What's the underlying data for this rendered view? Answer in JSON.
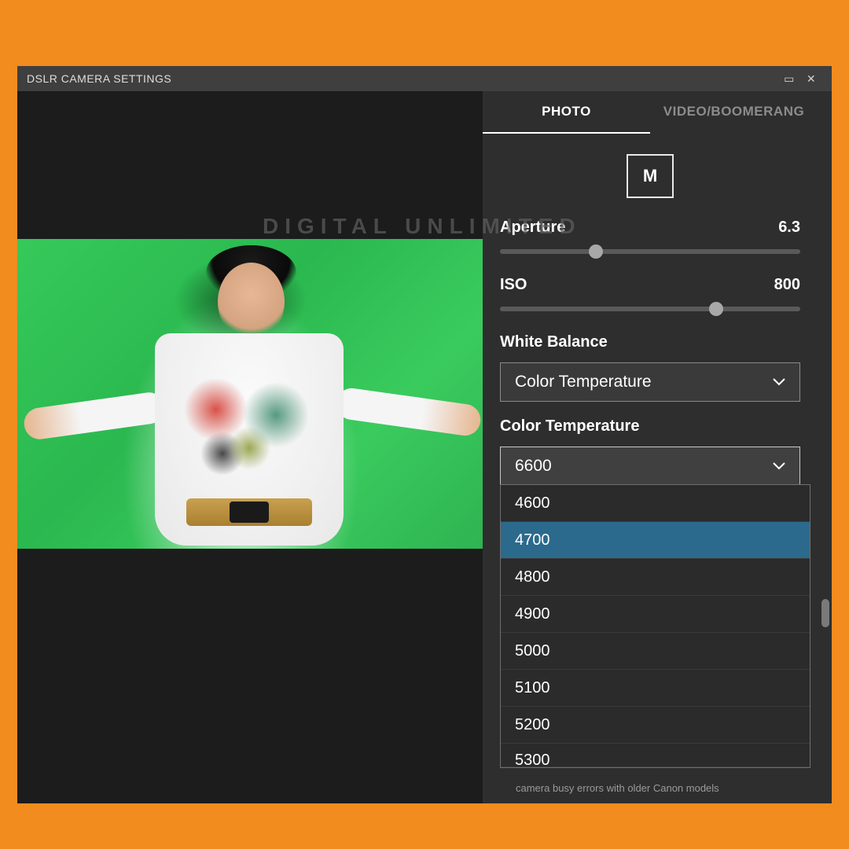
{
  "window": {
    "title": "DSLR CAMERA SETTINGS"
  },
  "watermark": "DIGITAL UNLIMITED",
  "tabs": {
    "photo": "PHOTO",
    "video": "VIDEO/BOOMERANG"
  },
  "mode": "M",
  "aperture": {
    "label": "Aperture",
    "value": "6.3",
    "position_pct": 32
  },
  "iso": {
    "label": "ISO",
    "value": "800",
    "position_pct": 72
  },
  "white_balance": {
    "label": "White Balance",
    "selected": "Color Temperature"
  },
  "color_temp": {
    "label": "Color Temperature",
    "selected": "6600",
    "options": [
      "4600",
      "4700",
      "4800",
      "4900",
      "5000",
      "5100",
      "5200",
      "5300"
    ],
    "highlighted": "4700"
  },
  "footnote": "camera busy errors with older Canon models"
}
